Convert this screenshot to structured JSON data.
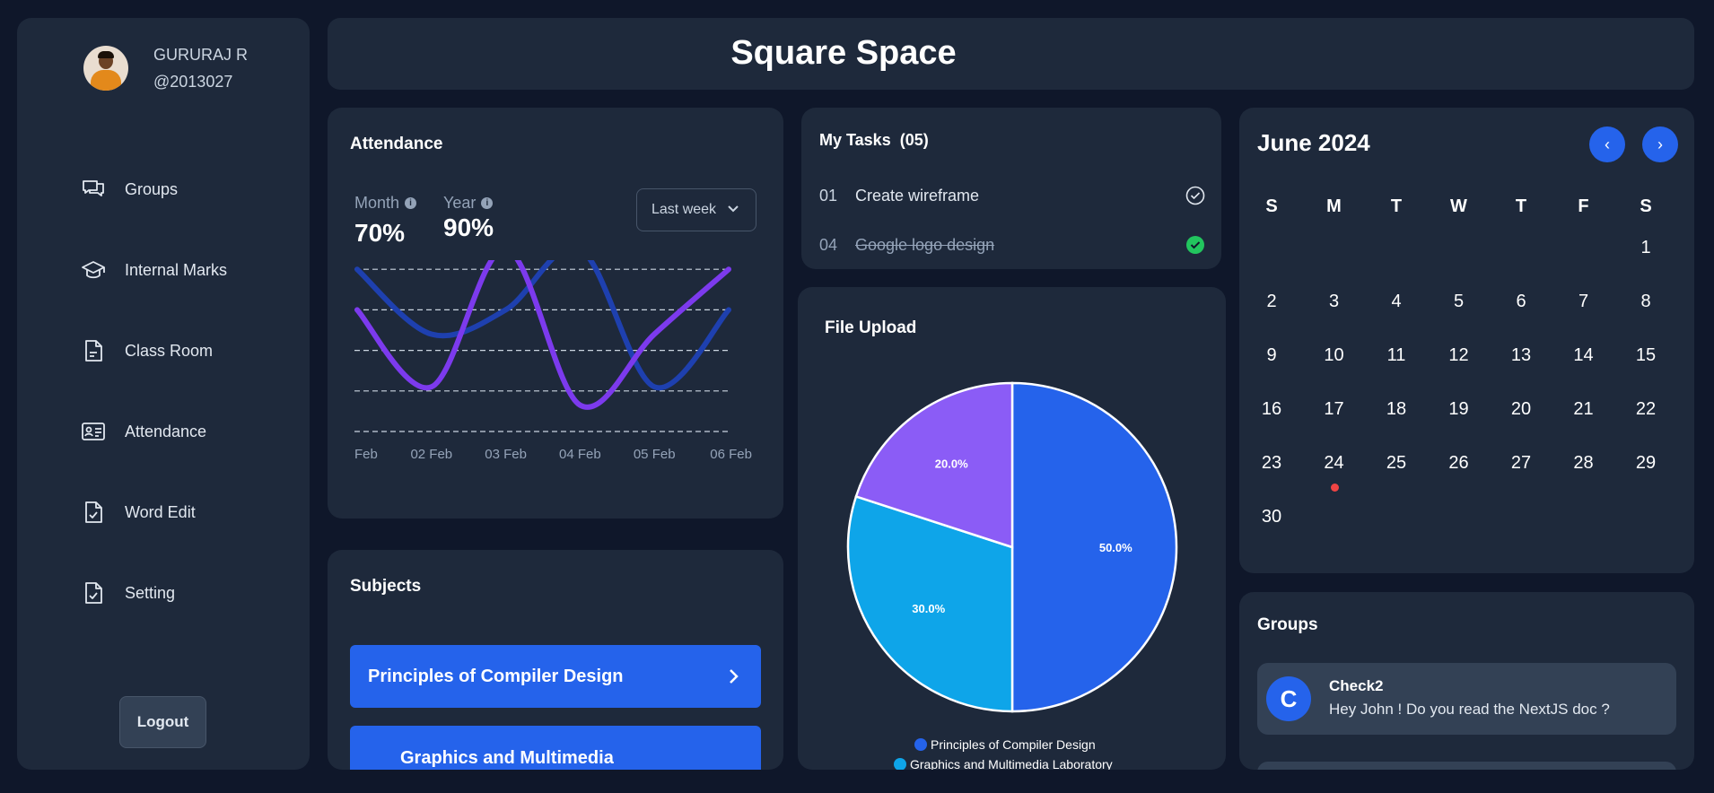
{
  "header": {
    "title": "Square Space"
  },
  "profile": {
    "name": "GURURAJ R",
    "handle": "@2013027"
  },
  "sidebar": {
    "items": [
      {
        "label": "Groups",
        "icon": "chat-icon"
      },
      {
        "label": "Internal Marks",
        "icon": "graduation-cap-icon"
      },
      {
        "label": "Class Room",
        "icon": "document-icon"
      },
      {
        "label": "Attendance",
        "icon": "id-card-icon"
      },
      {
        "label": "Word Edit",
        "icon": "file-check-icon"
      },
      {
        "label": "Setting",
        "icon": "file-check-icon"
      }
    ],
    "logout_label": "Logout"
  },
  "attendance": {
    "title": "Attendance",
    "month_label": "Month",
    "month_value": "70%",
    "year_label": "Year",
    "year_value": "90%",
    "range_select": "Last week"
  },
  "chart_data": {
    "type": "line",
    "categories": [
      "Feb",
      "02 Feb",
      "03 Feb",
      "04 Feb",
      "05 Feb",
      "06 Feb"
    ],
    "ylim": [
      0,
      100
    ],
    "grid": true,
    "smooth": true,
    "series": [
      {
        "color": "#1e40af",
        "values": [
          80,
          48,
          60,
          90,
          22,
          60
        ]
      },
      {
        "color": "#7c3aed",
        "values": [
          60,
          22,
          90,
          13,
          48,
          80
        ]
      }
    ]
  },
  "subjects": {
    "title": "Subjects",
    "items": [
      "Principles of Compiler Design",
      "Graphics and Multimedia"
    ]
  },
  "tasks": {
    "title": "My Tasks",
    "count": "(05)",
    "items": [
      {
        "num": "01",
        "text": "Create wireframe",
        "done": false
      },
      {
        "num": "04",
        "text": "Google logo design",
        "done": true
      }
    ]
  },
  "upload": {
    "title": "File Upload",
    "pie": [
      {
        "label": "Principles of Compiler Design",
        "value": 50,
        "text": "50.0%",
        "color": "#2563eb"
      },
      {
        "label": "Graphics and Multimedia Laboratory",
        "value": 30,
        "text": "30.0%",
        "color": "#0ea5e9"
      },
      {
        "value": 20,
        "text": "20.0%",
        "color": "#8b5cf6"
      }
    ]
  },
  "calendar": {
    "title": "June 2024",
    "prev": "‹",
    "next": "›",
    "weekdays": [
      "S",
      "M",
      "T",
      "W",
      "T",
      "F",
      "S"
    ],
    "first_weekday": 6,
    "days": 30,
    "marked_day": 24
  },
  "groups": {
    "title": "Groups",
    "items": [
      {
        "initial": "C",
        "name": "Check2",
        "message": "Hey John ! Do you read the NextJS doc ?"
      }
    ]
  },
  "colors": {
    "background": "#0f172a",
    "panel": "#1e293b",
    "accent": "#2563eb",
    "task_done": "#22c55e"
  }
}
